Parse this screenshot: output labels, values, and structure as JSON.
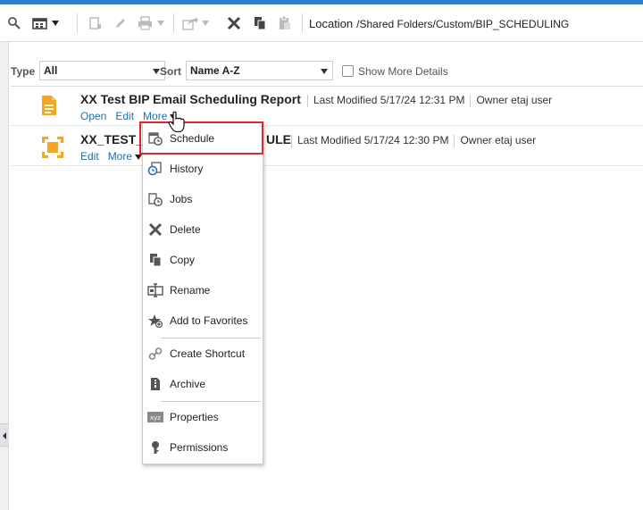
{
  "toolbar": {
    "location_label": "Location",
    "location_path": "/Shared Folders/Custom/BIP_SCHEDULING",
    "icons": [
      "search-icon",
      "view-icon",
      "upload-icon",
      "edit-icon",
      "print-icon",
      "share-icon",
      "delete-icon",
      "copy-icon",
      "paste-icon"
    ]
  },
  "filters": {
    "type_label": "Type",
    "type_value": "All",
    "sort_label": "Sort",
    "sort_value": "Name A-Z",
    "show_more_label": "Show More Details"
  },
  "items": [
    {
      "title": "XX Test BIP Email Scheduling Report",
      "last_modified": "Last Modified 5/17/24 12:31 PM",
      "owner": "Owner etaj user",
      "links": [
        "Open",
        "Edit",
        "More"
      ]
    },
    {
      "title_visible_start": "XX_TEST_",
      "title_visible_end": "ULE",
      "last_modified": "Last Modified 5/17/24 12:30 PM",
      "owner": "Owner etaj user",
      "links": [
        "Edit",
        "More"
      ]
    }
  ],
  "menu": {
    "items": [
      {
        "label": "Schedule",
        "icon": "schedule-icon"
      },
      {
        "label": "History",
        "icon": "history-icon"
      },
      {
        "label": "Jobs",
        "icon": "jobs-icon"
      },
      {
        "label": "Delete",
        "icon": "delete-icon"
      },
      {
        "label": "Copy",
        "icon": "copy-icon"
      },
      {
        "label": "Rename",
        "icon": "rename-icon"
      },
      {
        "label": "Add to Favorites",
        "icon": "favorites-icon"
      },
      {
        "label": "Create Shortcut",
        "icon": "shortcut-icon"
      },
      {
        "label": "Archive",
        "icon": "archive-icon"
      },
      {
        "label": "Properties",
        "icon": "properties-icon"
      },
      {
        "label": "Permissions",
        "icon": "permissions-icon"
      }
    ]
  },
  "colors": {
    "accent": "#2f7fd0",
    "link": "#1d6fb8",
    "report_icon": "#f5a623",
    "highlight_border": "#e0262c"
  }
}
